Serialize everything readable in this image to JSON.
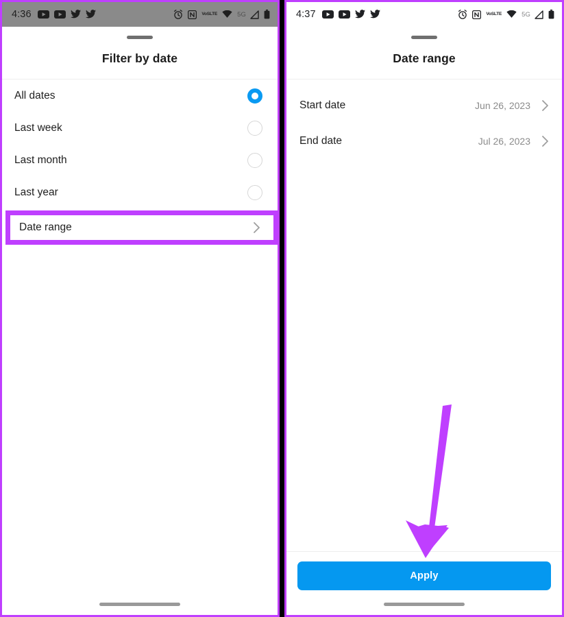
{
  "colors": {
    "annotation_purple": "#bf3fff",
    "accent_blue": "#0598f0",
    "radio_selected": "#0a9af2",
    "value_gray": "#8b8b8b",
    "divider": "#ededed"
  },
  "left_panel": {
    "status_bar": {
      "time": "4:36",
      "network_label": "5G",
      "volte_top": "VoS",
      "volte_bottom": "LTE",
      "left_icons": [
        "youtube-icon",
        "youtube-icon",
        "twitter-icon",
        "twitter-icon"
      ],
      "right_icons": [
        "alarm-icon",
        "nfc-icon",
        "volte-icon",
        "wifi-icon",
        "5g-label",
        "signal-icon",
        "battery-icon"
      ]
    },
    "sheet": {
      "title": "Filter by date",
      "options": [
        {
          "label": "All dates",
          "selected": true
        },
        {
          "label": "Last week",
          "selected": false
        },
        {
          "label": "Last month",
          "selected": false
        },
        {
          "label": "Last year",
          "selected": false
        }
      ],
      "date_range_row": {
        "label": "Date range",
        "highlighted": true
      }
    }
  },
  "right_panel": {
    "status_bar": {
      "time": "4:37",
      "network_label": "5G",
      "volte_top": "VoS",
      "volte_bottom": "LTE",
      "left_icons": [
        "youtube-icon",
        "youtube-icon",
        "twitter-icon",
        "twitter-icon"
      ],
      "right_icons": [
        "alarm-icon",
        "nfc-icon",
        "volte-icon",
        "wifi-icon",
        "5g-label",
        "signal-icon",
        "battery-icon"
      ]
    },
    "sheet": {
      "title": "Date range",
      "rows": [
        {
          "label": "Start date",
          "value": "Jun 26, 2023"
        },
        {
          "label": "End date",
          "value": "Jul 26, 2023"
        }
      ],
      "apply_label": "Apply"
    }
  },
  "annotations": {
    "arrow": {
      "name": "arrow-pointing-to-apply-button",
      "color": "#bf3fff"
    },
    "highlight_border": {
      "name": "highlight-box-date-range",
      "color": "#bf3fff"
    }
  }
}
